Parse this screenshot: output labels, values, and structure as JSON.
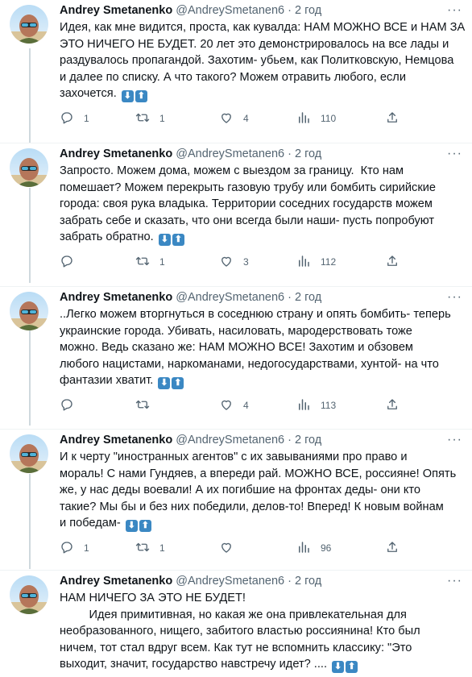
{
  "tweets": [
    {
      "name": "Andrey Smetanenko",
      "handle": "@AndreySmetanen6",
      "dot": "·",
      "time": "2 год",
      "lines": [
        "Идея, как мне видится, проста, как кувалда: НАМ МОЖНО ВСЕ и НАМ ЗА",
        "ЭТО НИЧЕГО НЕ БУДЕТ. 20 лет это демонстрировалось на все лады и",
        "раздувалось пропагандой. Захотим- убьем, как Политковскую, Немцова",
        "и далее по списку. А что такого? Можем отравить любого, если",
        "захочется."
      ],
      "replies": "1",
      "retweets": "1",
      "likes": "4",
      "views": "110"
    },
    {
      "name": "Andrey Smetanenko",
      "handle": "@AndreySmetanen6",
      "dot": "·",
      "time": "2 год",
      "lines": [
        "Запросто. Можем дома, можем с выездом за границу.  Кто нам",
        "помешает? Можем перекрыть газовую трубу или бомбить сирийские",
        "города: своя рука владыка. Территории соседних государств можем",
        "забрать себе и сказать, что они всегда были наши- пусть попробуют",
        "забрать обратно."
      ],
      "replies": "",
      "retweets": "1",
      "likes": "3",
      "views": "112"
    },
    {
      "name": "Andrey Smetanenko",
      "handle": "@AndreySmetanen6",
      "dot": "·",
      "time": "2 год",
      "lines": [
        "..Легко можем вторгнуться в соседнюю страну и опять бомбить- теперь",
        "украинские города. Убивать, насиловать, мародерствовать тоже",
        "можно. Ведь сказано же: НАМ МОЖНО ВСЕ! Захотим и обзовем",
        "любого нацистами, наркоманами, недогосударствами, хунтой- на что",
        "фантазии хватит."
      ],
      "replies": "",
      "retweets": "",
      "likes": "4",
      "views": "113"
    },
    {
      "name": "Andrey Smetanenko",
      "handle": "@AndreySmetanen6",
      "dot": "·",
      "time": "2 год",
      "lines": [
        "И к черту \"иностранных агентов\" с их завываниями про право и",
        "мораль! С нами Гундяев, а впереди рай. МОЖНО ВСЕ, россияне! Опять",
        "же, у нас деды воевали! А их погибшие на фронтах деды- они кто",
        "такие? Мы бы и без них победили, делов-то! Вперед! К новым войнам",
        "и победам-"
      ],
      "replies": "1",
      "retweets": "1",
      "likes": "",
      "views": "96"
    },
    {
      "name": "Andrey Smetanenko",
      "handle": "@AndreySmetanen6",
      "dot": "·",
      "time": "2 год",
      "lines": [
        "НАМ НИЧЕГО ЗА ЭТО НЕ БУДЕТ!",
        "         Идея примитивная, но какая же она привлекательная для",
        "необразованного, нищего, забитого властью россиянина! Кто был",
        "ничем, тот стал вдруг всем. Как тут не вспомнить классику: \"Это",
        "выходит, значит, государство навстречу идет? ...."
      ],
      "replies": "",
      "retweets": "",
      "likes": "",
      "views": ""
    }
  ],
  "emoji": {
    "down": "⬇",
    "up": "⬆"
  },
  "more_label": "···",
  "colors": {
    "meta": "#536471",
    "emoji_bg": "#3b88c3",
    "separator": "#eff3f4"
  },
  "icons": [
    "reply-icon",
    "retweet-icon",
    "like-icon",
    "views-icon",
    "share-icon",
    "more-icon",
    "arrow-down-emoji",
    "arrow-up-emoji"
  ]
}
